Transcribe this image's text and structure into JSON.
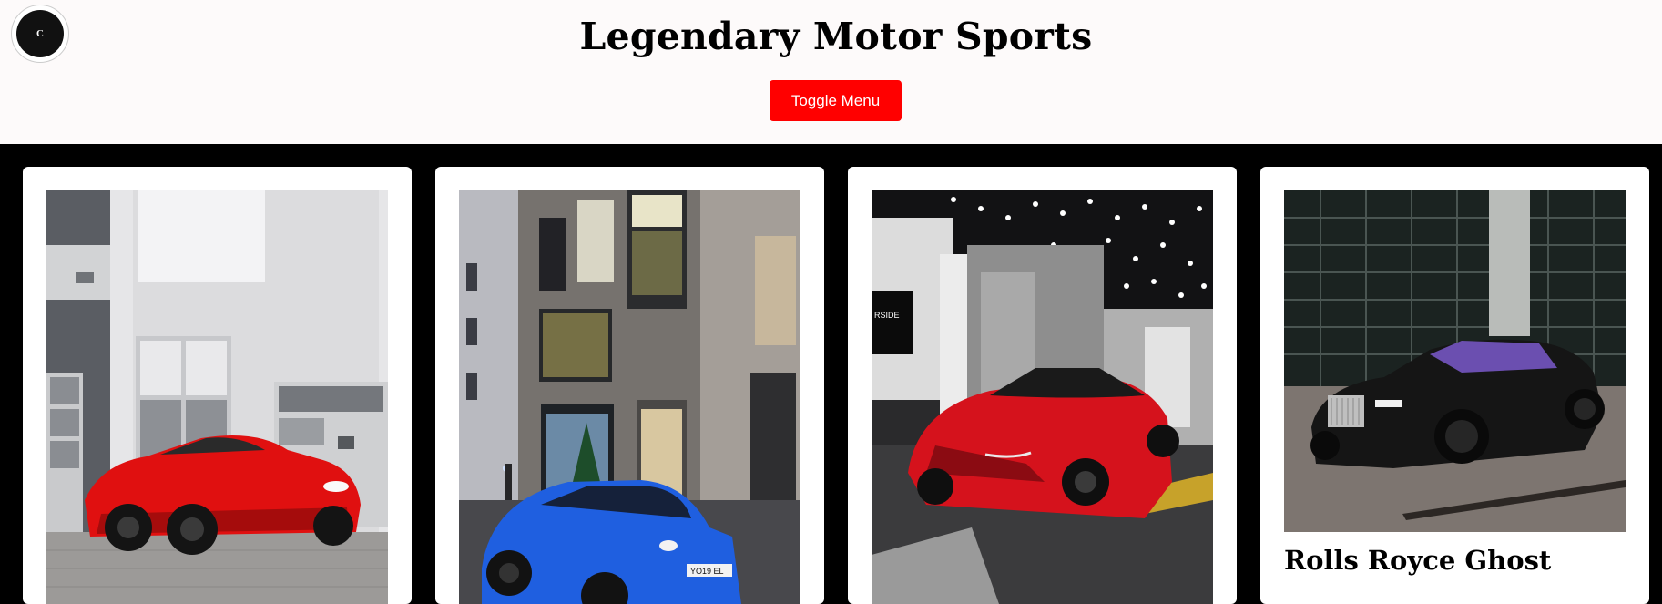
{
  "header": {
    "logo_letter": "C",
    "title": "Legendary Motor Sports",
    "toggle_label": "Toggle Menu"
  },
  "cards": [
    {
      "icon": "ferrari-car-photo",
      "body_color": "#e01010"
    },
    {
      "icon": "porsche-car-photo",
      "body_color": "#1f5fe0",
      "plate": "YO19 EL"
    },
    {
      "icon": "mclaren-car-photo",
      "body_color": "#d5121c",
      "sign": "SHOPS AT RIVERSIDE"
    },
    {
      "icon": "rolls-royce-car-photo",
      "body_color": "#151515",
      "title": "Rolls Royce Ghost"
    }
  ],
  "colors": {
    "accent": "#ff0000",
    "header_bg": "#fdfafa",
    "page_bg": "#000000"
  }
}
